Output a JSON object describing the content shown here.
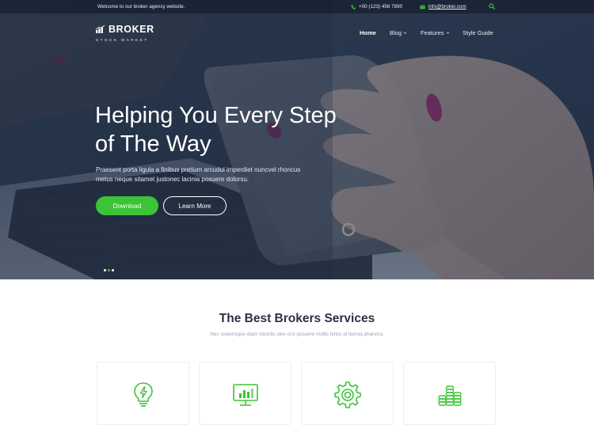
{
  "topbar": {
    "welcome": "Welcome to our broker agency website.",
    "phone": "+00 (123) 456 7890",
    "email": "info@broker.com"
  },
  "brand": {
    "name": "BROKER",
    "tagline": "STOCK MARKET"
  },
  "nav": {
    "items": [
      {
        "label": "Home",
        "active": true
      },
      {
        "label": "Blog",
        "dropdown": true
      },
      {
        "label": "Features",
        "dropdown": true
      },
      {
        "label": "Style Guide"
      }
    ]
  },
  "hero": {
    "title_line1": "Helping You Every Step",
    "title_line2": "of The Way",
    "description_line1": "Praesent porta ligula a finibus pretium arcudui imperdiet nuncvel rhoncus",
    "description_line2": "metus neque sitamet justonec lacinia posuere dolorsu.",
    "primary_button": "Download",
    "secondary_button": "Learn More",
    "slides": 3,
    "active_slide": 1
  },
  "services": {
    "title": "The Best Brokers Services",
    "subtitle": "Nec scelerisque diam lobortis ulex orci posuere mollis tellus id lacinia pharetra.",
    "cards": [
      {
        "icon": "lightbulb-icon"
      },
      {
        "icon": "monitor-chart-icon"
      },
      {
        "icon": "gear-icon"
      },
      {
        "icon": "coins-stack-icon"
      }
    ]
  },
  "colors": {
    "accent": "#3dc337",
    "hero_overlay": "#23334a",
    "title": "#2b3242",
    "muted": "#9aa3b3"
  }
}
